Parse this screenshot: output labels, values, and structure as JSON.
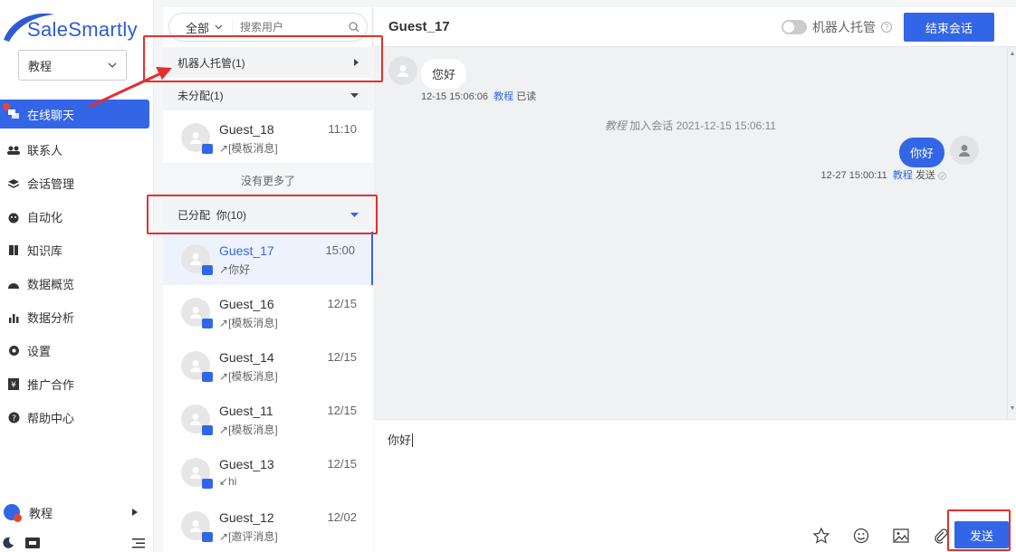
{
  "brand": {
    "name": "SaleSmartly"
  },
  "workspace": {
    "selected": "教程"
  },
  "nav": {
    "items": [
      {
        "label": "在线聊天",
        "icon": "chat-icon",
        "active": true
      },
      {
        "label": "联系人",
        "icon": "contacts-icon"
      },
      {
        "label": "会话管理",
        "icon": "layers-icon"
      },
      {
        "label": "自动化",
        "icon": "robot-icon"
      },
      {
        "label": "知识库",
        "icon": "book-icon"
      },
      {
        "label": "数据概览",
        "icon": "dashboard-icon"
      },
      {
        "label": "数据分析",
        "icon": "bar-chart-icon"
      },
      {
        "label": "设置",
        "icon": "gear-icon"
      },
      {
        "label": "推广合作",
        "icon": "yen-icon"
      },
      {
        "label": "帮助中心",
        "icon": "help-icon"
      }
    ],
    "user": "教程"
  },
  "convlist": {
    "filter": "全部",
    "search_placeholder": "搜索用户",
    "groups": {
      "robot": "机器人托管(1)",
      "unassigned": "未分配(1)",
      "assigned_label": "已分配",
      "assigned_you": "你(10)"
    },
    "unassigned_items": [
      {
        "name": "Guest_18",
        "time": "11:10",
        "preview": "[模板消息]",
        "dir": "↗"
      }
    ],
    "no_more": "没有更多了",
    "assigned_items": [
      {
        "name": "Guest_17",
        "time": "15:00",
        "preview": "你好",
        "dir": "↗"
      },
      {
        "name": "Guest_16",
        "time": "12/15",
        "preview": "[模板消息]",
        "dir": "↗"
      },
      {
        "name": "Guest_14",
        "time": "12/15",
        "preview": "[模板消息]",
        "dir": "↗"
      },
      {
        "name": "Guest_11",
        "time": "12/15",
        "preview": "[模板消息]",
        "dir": "↗"
      },
      {
        "name": "Guest_13",
        "time": "12/15",
        "preview": "hi",
        "dir": "↙"
      },
      {
        "name": "Guest_12",
        "time": "12/02",
        "preview": "[邀评消息]",
        "dir": "↗"
      }
    ]
  },
  "chat": {
    "title": "Guest_17",
    "robot_toggle_label": "机器人托管",
    "end_button": "结束会话",
    "messages": {
      "incoming_text": "您好",
      "incoming_time": "12-15 15:06:06",
      "incoming_who": "教程",
      "incoming_status": "已读",
      "system_who": "教程",
      "system_text": "加入会话 2021-12-15 15:06:11",
      "outgoing_text": "你好",
      "outgoing_time": "12-27 15:00:11",
      "outgoing_who": "教程",
      "outgoing_status": "发送"
    },
    "compose_text": "你好",
    "send_button": "发送"
  },
  "colors": {
    "accent": "#3366e6",
    "annotation": "#e52e2e",
    "unread": "#e4482c"
  }
}
